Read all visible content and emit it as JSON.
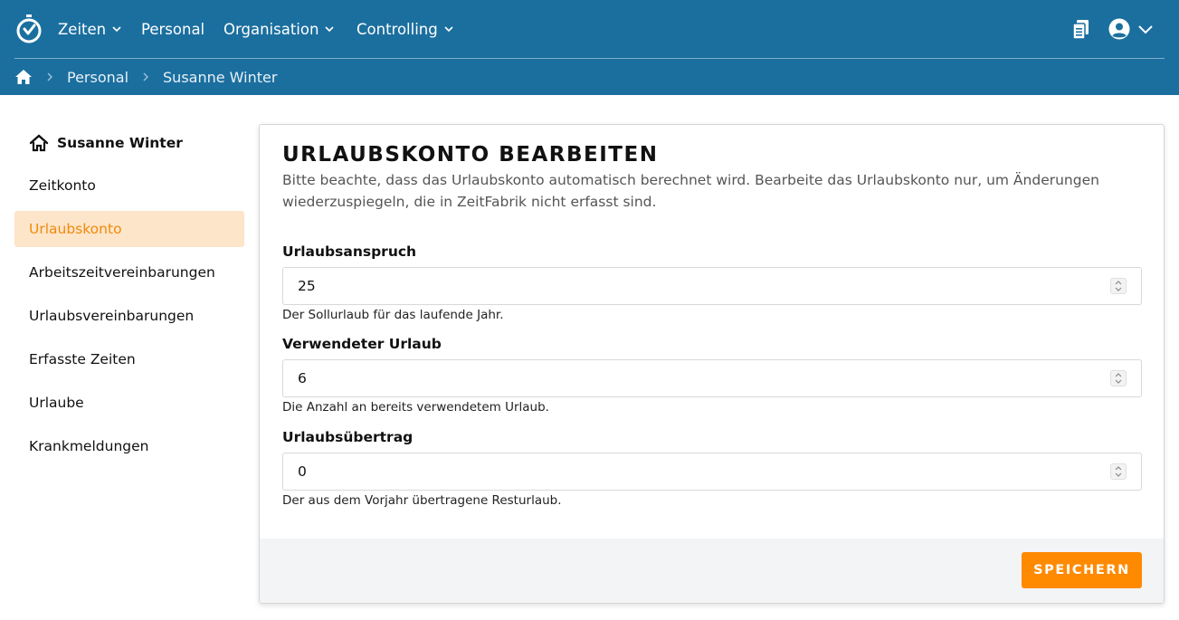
{
  "nav": {
    "items": [
      {
        "label": "Zeiten",
        "has_dropdown": true
      },
      {
        "label": "Personal",
        "has_dropdown": false
      },
      {
        "label": "Organisation",
        "has_dropdown": true
      },
      {
        "label": "Controlling",
        "has_dropdown": true
      }
    ],
    "right_icons": [
      "clipboard-icon",
      "user-circle-icon",
      "chevron-down-icon"
    ]
  },
  "breadcrumb": {
    "home_icon": "home-icon",
    "items": [
      "Personal",
      "Susanne Winter"
    ]
  },
  "sidebar": {
    "title": "Susanne Winter",
    "title_icon": "home-icon",
    "items": [
      {
        "label": "Zeitkonto",
        "active": false
      },
      {
        "label": "Urlaubskonto",
        "active": true
      },
      {
        "label": "Arbeitszeitvereinbarungen",
        "active": false
      },
      {
        "label": "Urlaubsvereinbarungen",
        "active": false
      },
      {
        "label": "Erfasste Zeiten",
        "active": false
      },
      {
        "label": "Urlaube",
        "active": false
      },
      {
        "label": "Krankmeldungen",
        "active": false
      }
    ]
  },
  "form": {
    "title": "URLAUBSKONTO BEARBEITEN",
    "description": "Bitte beachte, dass das Urlaubskonto automatisch berechnet wird. Bearbeite das Urlaubskonto nur, um Änderungen wiederzuspiegeln, die in ZeitFabrik nicht erfasst sind.",
    "fields": [
      {
        "label": "Urlaubsanspruch",
        "value": "25",
        "help": "Der Sollurlaub für das laufende Jahr."
      },
      {
        "label": "Verwendeter Urlaub",
        "value": "6",
        "help": "Die Anzahl an bereits verwendetem Urlaub."
      },
      {
        "label": "Urlaubsübertrag",
        "value": "0",
        "help": "Der aus dem Vorjahr übertragene Resturlaub."
      }
    ],
    "save_label": "SPEICHERN"
  },
  "colors": {
    "header_bg": "#1b6f9f",
    "accent": "#ff8a00",
    "active_bg": "#fde5c9",
    "active_text": "#f08a0c"
  }
}
